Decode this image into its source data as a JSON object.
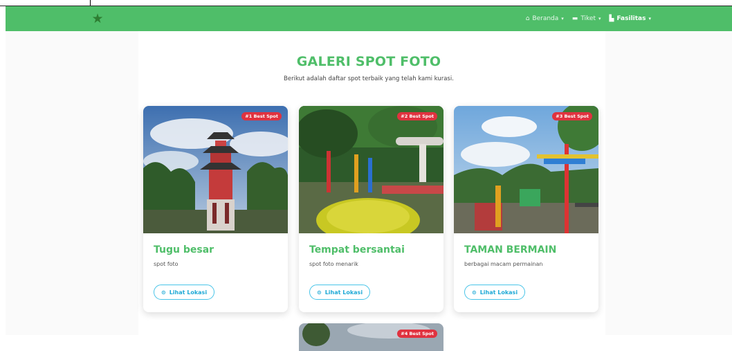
{
  "nav": {
    "items": [
      {
        "label": "Beranda",
        "icon": "home-icon"
      },
      {
        "label": "Tiket",
        "icon": "ticket-icon"
      },
      {
        "label": "Fasilitas",
        "icon": "building-icon"
      }
    ]
  },
  "hero": {
    "title": "GALERI SPOT FOTO",
    "subtitle": "Berikut adalah daftar spot terbaik yang telah kami kurasi."
  },
  "cards": [
    {
      "badge": "#1 Best Spot",
      "title": "Tugu besar",
      "desc": "spot foto",
      "button": "Lihat Lokasi"
    },
    {
      "badge": "#2 Best Spot",
      "title": "Tempat bersantai",
      "desc": "spot foto menarik",
      "button": "Lihat Lokasi"
    },
    {
      "badge": "#3 Best Spot",
      "title": "TAMAN BERMAIN",
      "desc": "berbagai macam permainan",
      "button": "Lihat Lokasi"
    },
    {
      "badge": "#4 Best Spot"
    }
  ],
  "colors": {
    "brand": "#4fbe69",
    "badge": "#e0323f",
    "button": "#1ea9d6"
  }
}
